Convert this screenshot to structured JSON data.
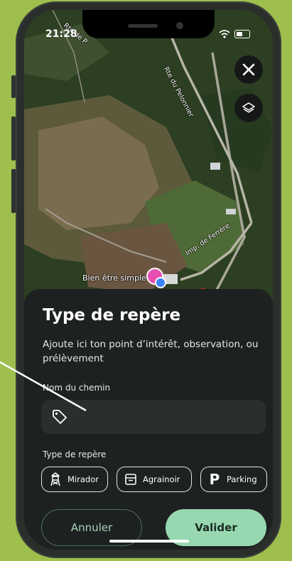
{
  "status_bar": {
    "time": "21:28"
  },
  "map": {
    "roads": {
      "road1": "Rte du Pelonnier",
      "road2": "Imp. de Ferrère",
      "road3": "Rte de P"
    },
    "poi_label": "Bien être simple",
    "close_icon": "close-icon",
    "layers_icon": "layers-icon"
  },
  "sheet": {
    "title": "Type de repère",
    "subtitle": "Ajoute ici ton point d’intérêt, observation, ou prélèvement",
    "name_field": {
      "label": "Nom du chemin",
      "value": "",
      "placeholder": "",
      "icon": "tag-icon"
    },
    "type_label": "Type de repère",
    "types": [
      {
        "label": "Mirador",
        "icon": "watchtower-icon"
      },
      {
        "label": "Agrainoir",
        "icon": "feeder-icon"
      },
      {
        "label": "Parking",
        "icon": "parking-icon"
      }
    ],
    "cancel_label": "Annuler",
    "confirm_label": "Valider"
  },
  "colors": {
    "accent": "#98d8b0",
    "background": "#9ebf4d",
    "sheet": "#1d2121"
  }
}
